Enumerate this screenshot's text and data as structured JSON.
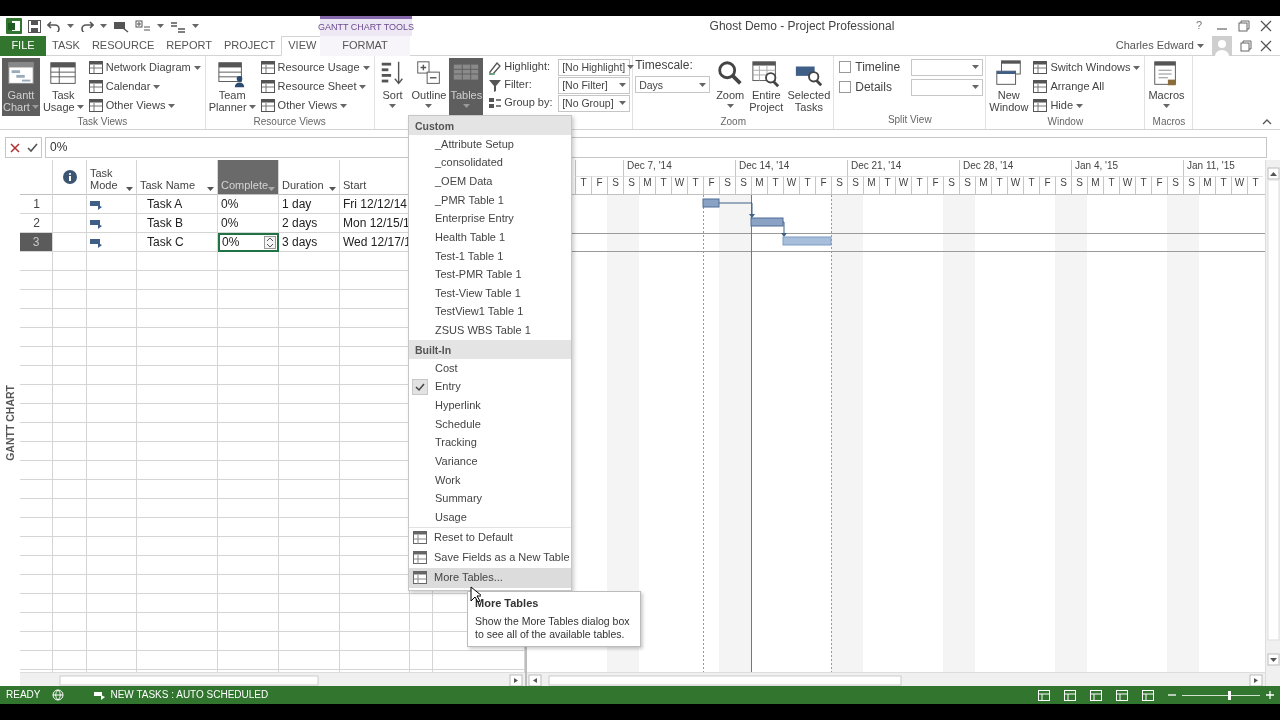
{
  "window": {
    "title": "Ghost Demo - Project Professional",
    "contextual_group": "GANTT CHART TOOLS",
    "help_button": "?",
    "user": "Charles Edward"
  },
  "tabs": [
    {
      "label": "FILE",
      "kind": "file",
      "selected": false
    },
    {
      "label": "TASK",
      "kind": "tab",
      "selected": false
    },
    {
      "label": "RESOURCE",
      "kind": "tab",
      "selected": false
    },
    {
      "label": "REPORT",
      "kind": "tab",
      "selected": false
    },
    {
      "label": "PROJECT",
      "kind": "tab",
      "selected": false
    },
    {
      "label": "VIEW",
      "kind": "tab",
      "selected": true
    },
    {
      "label": "FORMAT",
      "kind": "contextual",
      "selected": false
    }
  ],
  "ribbon_groups": [
    {
      "label": "Task Views",
      "controls": [
        {
          "kind": "large",
          "lines": [
            "Gantt",
            "Chart"
          ],
          "menu": true,
          "selected": true
        },
        {
          "kind": "large",
          "lines": [
            "Task",
            "Usage"
          ],
          "menu": true,
          "selected": false
        },
        {
          "kind": "stack",
          "items": [
            {
              "label": "Network Diagram",
              "menu": true
            },
            {
              "label": "Calendar",
              "menu": true
            },
            {
              "label": "Other Views",
              "menu": true
            }
          ]
        }
      ]
    },
    {
      "label": "Resource Views",
      "controls": [
        {
          "kind": "large",
          "lines": [
            "Team",
            "Planner"
          ],
          "menu": true,
          "selected": false
        },
        {
          "kind": "stack",
          "items": [
            {
              "label": "Resource Usage",
              "menu": true
            },
            {
              "label": "Resource Sheet",
              "menu": true
            },
            {
              "label": "Other Views",
              "menu": true
            }
          ]
        }
      ]
    },
    {
      "controls": [
        {
          "kind": "large",
          "lines": [
            "Sort"
          ],
          "menu": true,
          "selected": false
        },
        {
          "kind": "large",
          "lines": [
            "Outline"
          ],
          "menu": true,
          "selected": false
        },
        {
          "kind": "large",
          "lines": [
            "Tables"
          ],
          "menu": true,
          "selected": true
        },
        {
          "kind": "fields",
          "items": [
            {
              "label": "Highlight:",
              "value": "[No Highlight]"
            },
            {
              "label": "Filter:",
              "value": "[No Filter]"
            },
            {
              "label": "Group by:",
              "value": "[No Group]"
            }
          ]
        }
      ]
    },
    {
      "label": "Zoom",
      "controls": [
        {
          "kind": "timescale",
          "label": "Timescale:",
          "value": "Days"
        },
        {
          "kind": "large",
          "lines": [
            "Zoom"
          ],
          "menu": true,
          "selected": false
        },
        {
          "kind": "large",
          "lines": [
            "Entire",
            "Project"
          ],
          "menu": false,
          "selected": false
        },
        {
          "kind": "large",
          "lines": [
            "Selected",
            "Tasks"
          ],
          "menu": false,
          "selected": false
        }
      ]
    },
    {
      "label": "Split View",
      "controls": [
        {
          "kind": "checks",
          "items": [
            {
              "label": "Timeline",
              "checked": false
            },
            {
              "label": "Details",
              "checked": false
            }
          ]
        }
      ]
    },
    {
      "label": "Window",
      "controls": [
        {
          "kind": "large",
          "lines": [
            "New",
            "Window"
          ],
          "menu": false,
          "selected": false
        },
        {
          "kind": "stack",
          "items": [
            {
              "label": "Switch Windows",
              "menu": true
            },
            {
              "label": "Arrange All",
              "menu": false
            },
            {
              "label": "Hide",
              "menu": true
            }
          ]
        }
      ]
    },
    {
      "label": "Macros",
      "controls": [
        {
          "kind": "large",
          "lines": [
            "Macros"
          ],
          "menu": true,
          "selected": false
        }
      ]
    }
  ],
  "formula_bar": {
    "value": "0%"
  },
  "side_label": "GANTT CHART",
  "table": {
    "columns": [
      {
        "kind": "rownum"
      },
      {
        "kind": "info"
      },
      {
        "kind": "text",
        "label": "Task Mode",
        "filter": true,
        "selected": false
      },
      {
        "kind": "text",
        "label": "Task Name",
        "filter": true,
        "selected": false
      },
      {
        "kind": "text",
        "label": "Complete",
        "filter": true,
        "selected": true
      },
      {
        "kind": "text",
        "label": "Duration",
        "filter": true,
        "selected": false
      },
      {
        "kind": "text",
        "label": "Start",
        "filter": false,
        "selected": false
      },
      {
        "kind": "blank"
      },
      {
        "kind": "blank"
      }
    ],
    "rows": [
      {
        "id": "1",
        "name": "Task A",
        "complete": "0%",
        "duration": "1 day",
        "start": "Fri 12/12/14",
        "selected": false,
        "editing": false
      },
      {
        "id": "2",
        "name": "Task B",
        "complete": "0%",
        "duration": "2 days",
        "start": "Mon 12/15/1",
        "selected": false,
        "editing": false
      },
      {
        "id": "3",
        "name": "Task C",
        "complete": "0%",
        "duration": "3 days",
        "start": "Wed 12/17/1",
        "selected": true,
        "editing": true
      }
    ]
  },
  "gantt": {
    "weeks": [
      {
        "days": [
          "T",
          "F",
          "S"
        ]
      },
      {
        "label": "Dec 7, '14",
        "days": [
          "S",
          "M",
          "T",
          "W",
          "T",
          "F",
          "S"
        ]
      },
      {
        "label": "Dec 14, '14",
        "days": [
          "S",
          "M",
          "T",
          "W",
          "T",
          "F",
          "S"
        ]
      },
      {
        "label": "Dec 21, '14",
        "days": [
          "S",
          "M",
          "T",
          "W",
          "T",
          "F",
          "S"
        ]
      },
      {
        "label": "Dec 28, '14",
        "days": [
          "S",
          "M",
          "T",
          "W",
          "T",
          "F",
          "S"
        ]
      },
      {
        "label": "Jan 4, '15",
        "days": [
          "S",
          "M",
          "T",
          "W",
          "T",
          "F",
          "S"
        ]
      },
      {
        "label": "Jan 11, '15",
        "days": [
          "S",
          "M",
          "T",
          "W",
          "T"
        ]
      }
    ]
  },
  "tables_menu": {
    "sections": [
      {
        "header": "Custom",
        "items": [
          {
            "label": "_Attribute Setup",
            "checked": false
          },
          {
            "label": "_consolidated",
            "checked": false
          },
          {
            "label": "_OEM Data",
            "checked": false
          },
          {
            "label": "_PMR Table 1",
            "checked": false
          },
          {
            "label": "Enterprise Entry",
            "checked": false
          },
          {
            "label": "Health Table 1",
            "checked": false
          },
          {
            "label": "Test-1 Table 1",
            "checked": false
          },
          {
            "label": "Test-PMR Table 1",
            "checked": false
          },
          {
            "label": "Test-View Table 1",
            "checked": false
          },
          {
            "label": "TestView1 Table 1",
            "checked": false
          },
          {
            "label": "ZSUS WBS Table 1",
            "checked": false
          }
        ]
      },
      {
        "header": "Built-In",
        "items": [
          {
            "label": "Cost",
            "checked": false
          },
          {
            "label": "Entry",
            "checked": true
          },
          {
            "label": "Hyperlink",
            "checked": false
          },
          {
            "label": "Schedule",
            "checked": false
          },
          {
            "label": "Tracking",
            "checked": false
          },
          {
            "label": "Variance",
            "checked": false
          },
          {
            "label": "Work",
            "checked": false
          },
          {
            "label": "Summary",
            "checked": false
          },
          {
            "label": "Usage",
            "checked": false
          }
        ]
      }
    ],
    "actions": [
      {
        "label": "Reset to Default",
        "selected": false
      },
      {
        "label": "Save Fields as a New Table",
        "selected": false
      },
      {
        "label": "More Tables...",
        "selected": true
      }
    ]
  },
  "tooltip": {
    "title": "More Tables",
    "text": "Show the More Tables dialog box to see all of the available tables."
  },
  "status_bar": {
    "mode": "READY",
    "new_tasks": "NEW TASKS : AUTO SCHEDULED",
    "zoom": {
      "level": 0.6
    }
  }
}
